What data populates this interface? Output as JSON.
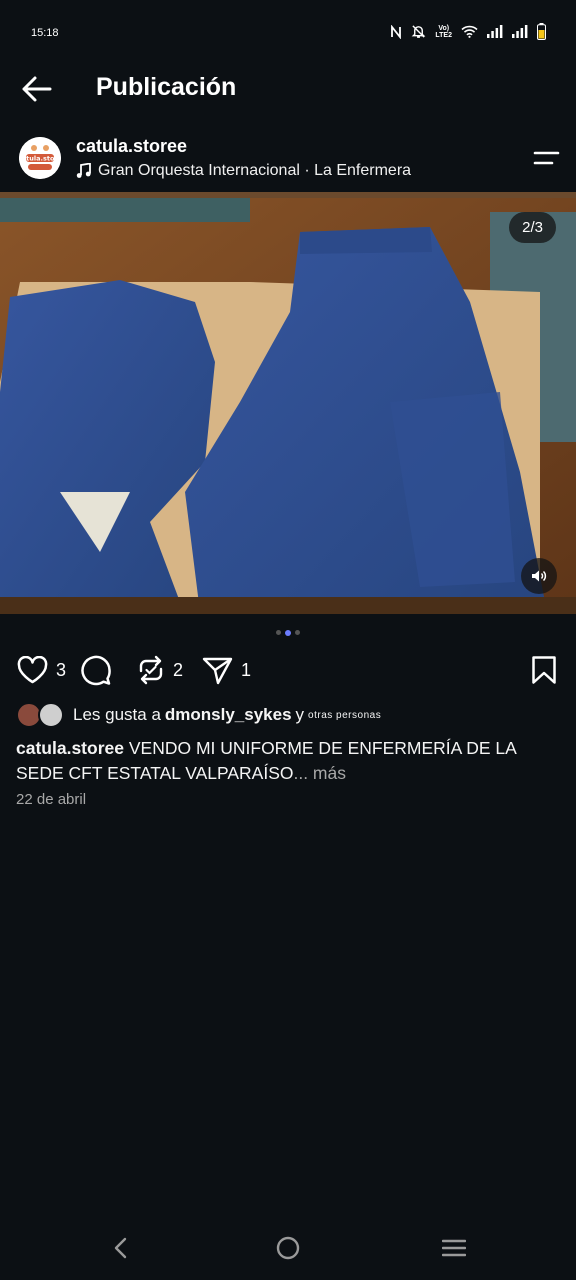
{
  "status_bar": {
    "time": "15:18",
    "volte": "Vo)",
    "lte": "LTE2"
  },
  "header": {
    "title": "Publicación"
  },
  "post": {
    "username": "catula.storee",
    "avatar_text": "catula.store",
    "music": "Gran Orquesta Internacional · La Enfermera",
    "media_counter": "2/3",
    "media_index": 2,
    "media_total": 3,
    "likes_count": "3",
    "comments_count": "",
    "reposts_count": "2",
    "shares_count": "1",
    "likes_text_prefix": "Les gusta a",
    "likes_user": "dmonsly_sykes",
    "likes_text_and": "y",
    "likes_text_others": "otras personas",
    "caption_user": "catula.storee",
    "caption_text": "VENDO MI UNIFORME DE ENFERMERÍA DE LA SEDE CFT ESTATAL VALPARAÍSO",
    "caption_more": "... más",
    "date": "22 de abril"
  },
  "icons": {
    "back": "arrow-left-icon",
    "options": "menu-icon",
    "music": "music-note-icon",
    "like": "heart-icon",
    "comment": "comment-icon",
    "repost": "repost-icon",
    "share": "send-icon",
    "save": "bookmark-icon",
    "volume": "speaker-icon"
  },
  "colors": {
    "background": "#0c1014",
    "accent_dot": "#6c7dff",
    "fabric": "#2d4f9e"
  }
}
